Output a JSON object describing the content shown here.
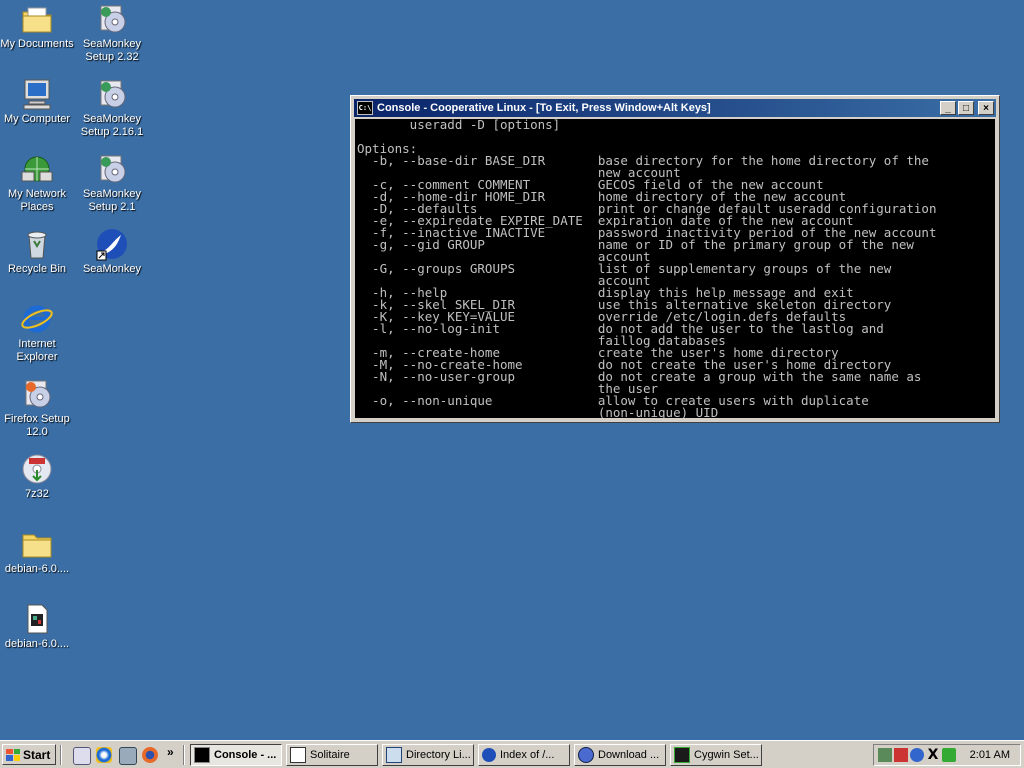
{
  "desktop": {
    "icons": [
      {
        "label": "My Documents"
      },
      {
        "label": "SeaMonkey Setup 2.32"
      },
      {
        "label": "My Computer"
      },
      {
        "label": "SeaMonkey Setup 2.16.1"
      },
      {
        "label": "My Network Places"
      },
      {
        "label": "SeaMonkey Setup 2.1"
      },
      {
        "label": "Recycle Bin"
      },
      {
        "label": "SeaMonkey"
      },
      {
        "label": "Internet Explorer"
      },
      {
        "label": "Firefox Setup 12.0"
      },
      {
        "label": "7z32"
      },
      {
        "label": "debian-6.0...."
      },
      {
        "label": "debian-6.0...."
      }
    ]
  },
  "console": {
    "title": "Console - Cooperative Linux - [To Exit, Press Window+Alt Keys]",
    "minimize_label": "_",
    "maximize_label": "□",
    "close_label": "×",
    "lines": [
      "       useradd -D [options]",
      "",
      "Options:",
      "  -b, --base-dir BASE_DIR       base directory for the home directory of the",
      "                                new account",
      "  -c, --comment COMMENT         GECOS field of the new account",
      "  -d, --home-dir HOME_DIR       home directory of the new account",
      "  -D, --defaults                print or change default useradd configuration",
      "  -e, --expiredate EXPIRE_DATE  expiration date of the new account",
      "  -f, --inactive INACTIVE       password inactivity period of the new account",
      "  -g, --gid GROUP               name or ID of the primary group of the new",
      "                                account",
      "  -G, --groups GROUPS           list of supplementary groups of the new",
      "                                account",
      "  -h, --help                    display this help message and exit",
      "  -k, --skel SKEL_DIR           use this alternative skeleton directory",
      "  -K, --key KEY=VALUE           override /etc/login.defs defaults",
      "  -l, --no-log-init             do not add the user to the lastlog and",
      "                                faillog databases",
      "  -m, --create-home             create the user's home directory",
      "  -M, --no-create-home          do not create the user's home directory",
      "  -N, --no-user-group           do not create a group with the same name as",
      "                                the user",
      "  -o, --non-unique              allow to create users with duplicate",
      "                                (non-unique) UID"
    ]
  },
  "taskbar": {
    "start_label": "Start",
    "more_label": "»",
    "tasks": [
      {
        "label": "Console - ..."
      },
      {
        "label": "Solitaire"
      },
      {
        "label": "Directory Li..."
      },
      {
        "label": "Index of /..."
      },
      {
        "label": "Download ..."
      },
      {
        "label": "Cygwin Set..."
      }
    ],
    "clock": "2:01 AM"
  },
  "colors": {
    "desktop": "#3a6ea5",
    "title_active": "#0a246a",
    "terminal_bg": "#000000",
    "terminal_fg": "#c0c0c0"
  }
}
